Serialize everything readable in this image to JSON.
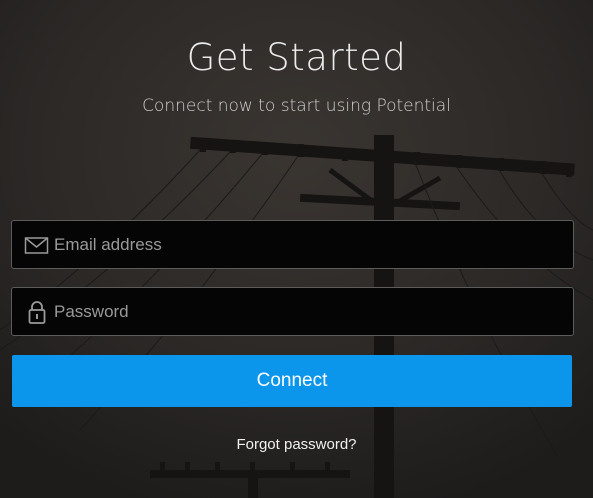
{
  "header": {
    "title": "Get Started",
    "subtitle": "Connect now to start using Potential"
  },
  "form": {
    "email_placeholder": "Email address",
    "email_icon": "envelope-icon",
    "password_placeholder": "Password",
    "password_icon": "lock-icon",
    "connect_label": "Connect",
    "forgot_label": "Forgot password?"
  },
  "colors": {
    "accent": "#0b96ec",
    "background": "#2a2826",
    "field_background": "#050505"
  }
}
